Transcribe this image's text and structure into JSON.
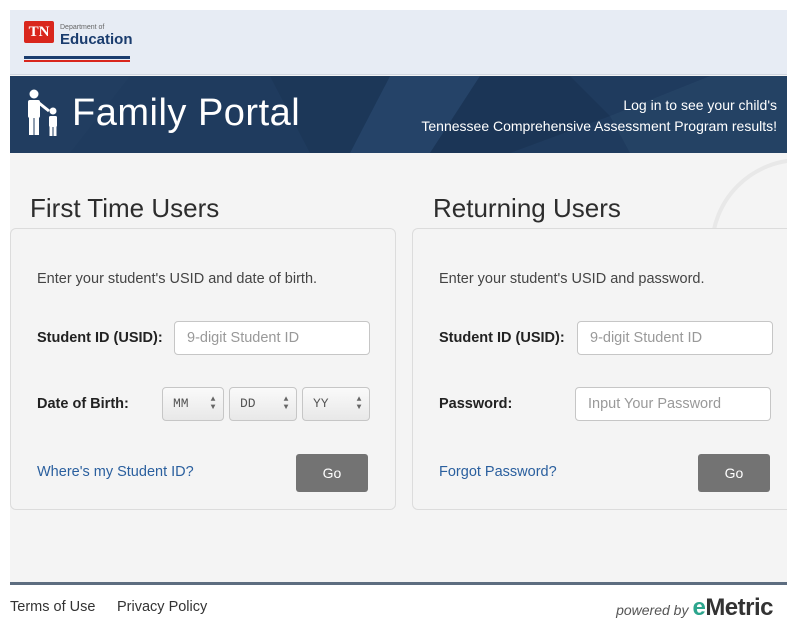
{
  "header": {
    "logo_abbrev": "TN",
    "logo_dept": "Department of",
    "logo_name": "Education"
  },
  "banner": {
    "icon": "parent-child-icon",
    "title": "Family Portal",
    "message_line1": "Log in to see your child's",
    "message_line2": "Tennessee Comprehensive Assessment Program results!"
  },
  "first_time": {
    "title": "First Time Users",
    "intro": "Enter your student's USID and date of birth.",
    "student_id_label": "Student ID (USID):",
    "student_id_placeholder": "9-digit Student ID",
    "dob_label": "Date of Birth:",
    "month": "MM",
    "day": "DD",
    "year": "YY",
    "help_link": "Where's my Student ID?",
    "go_label": "Go"
  },
  "returning": {
    "title": "Returning Users",
    "intro": "Enter your student's USID and password.",
    "student_id_label": "Student ID (USID):",
    "student_id_placeholder": "9-digit Student ID",
    "password_label": "Password:",
    "password_placeholder": "Input Your Password",
    "forgot_link": "Forgot Password?",
    "go_label": "Go"
  },
  "footer": {
    "terms": "Terms of Use",
    "privacy": "Privacy Policy",
    "powered_by": "powered by",
    "brand_e": "e",
    "brand_rest": "Metric"
  },
  "colors": {
    "banner": "#1f3b5e",
    "button": "#737373",
    "link": "#2a5f9e",
    "brand_accent": "#2ca58d",
    "logo_red": "#d9261c"
  }
}
